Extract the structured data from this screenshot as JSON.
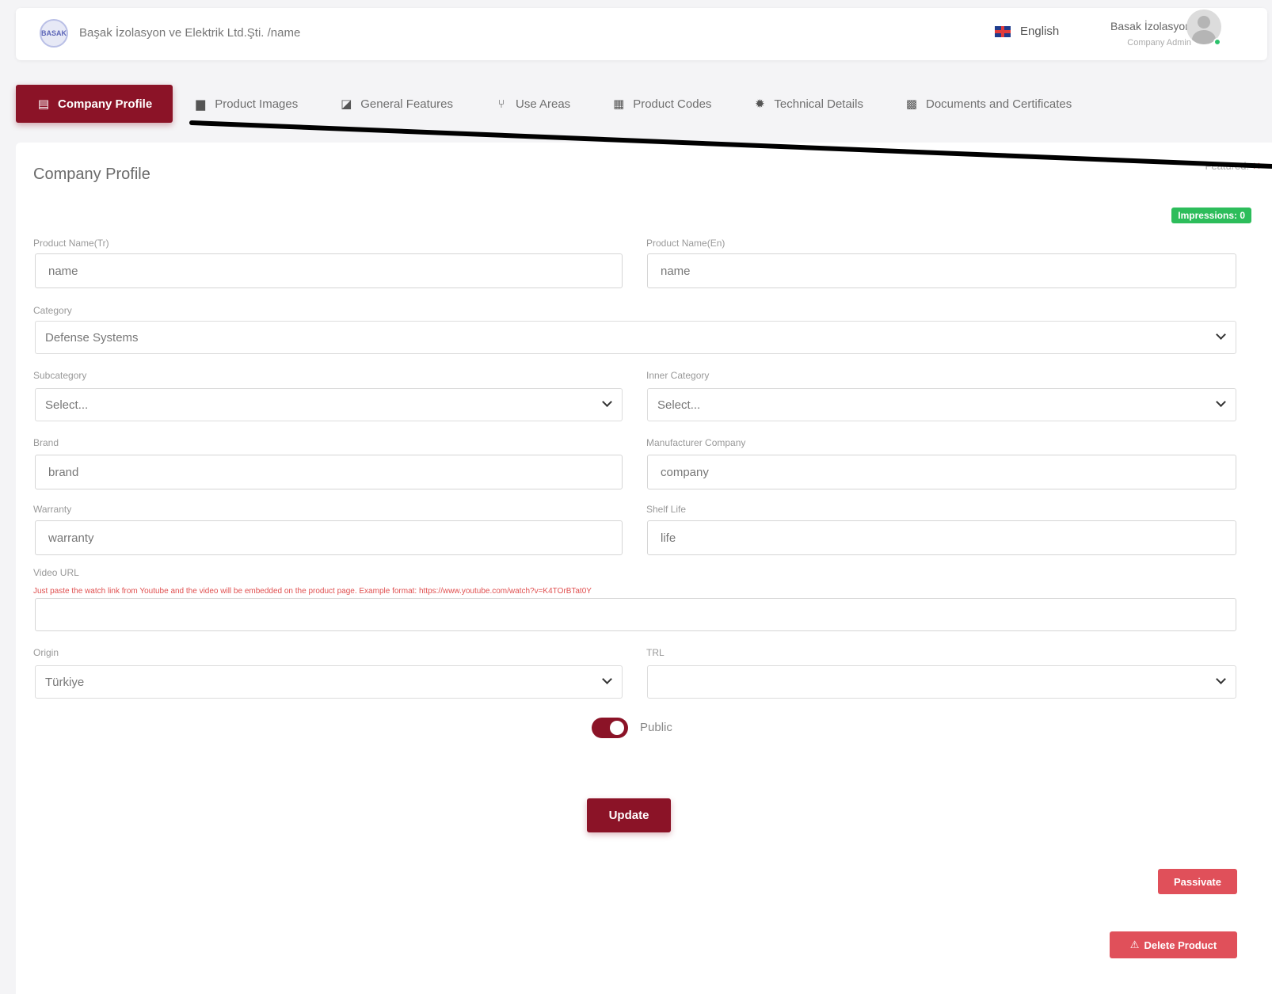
{
  "header": {
    "logo_text": "BASAK",
    "breadcrumb": "Başak İzolasyon ve Elektrik Ltd.Şti. /name",
    "language": "English",
    "user_name": "Basak İzolasyon",
    "user_role": "Company Admin"
  },
  "tabs": [
    {
      "label": "Company Profile",
      "icon": "id-card-icon",
      "glyph": "▤",
      "active": true
    },
    {
      "label": "Product Images",
      "icon": "image-icon",
      "glyph": "▆"
    },
    {
      "label": "General Features",
      "icon": "panel-icon",
      "glyph": "◪"
    },
    {
      "label": "Use Areas",
      "icon": "branch-icon",
      "glyph": "⑂"
    },
    {
      "label": "Product Codes",
      "icon": "qr-code-icon",
      "glyph": "▦"
    },
    {
      "label": "Technical Details",
      "icon": "gear-icon",
      "glyph": "✹"
    },
    {
      "label": "Documents and Certificates",
      "icon": "certificate-icon",
      "glyph": "▩"
    }
  ],
  "card": {
    "title": "Company Profile",
    "featured_label": "Featured:",
    "featured_value": "✕",
    "impressions": "Impressions: 0"
  },
  "form": {
    "product_name_tr": {
      "label": "Product Name(Tr)",
      "value": "name"
    },
    "product_name_en": {
      "label": "Product Name(En)",
      "value": "name"
    },
    "category": {
      "label": "Category",
      "value": "Defense Systems"
    },
    "subcategory": {
      "label": "Subcategory",
      "value": "Select..."
    },
    "inner_category": {
      "label": "Inner Category",
      "value": "Select..."
    },
    "brand": {
      "label": "Brand",
      "value": "brand"
    },
    "manufacturer": {
      "label": "Manufacturer Company",
      "value": "company"
    },
    "warranty": {
      "label": "Warranty",
      "value": "warranty"
    },
    "shelf_life": {
      "label": "Shelf Life",
      "value": "life"
    },
    "video_url": {
      "label": "Video URL",
      "hint": "Just paste the watch link from Youtube and the video will be embedded on the product page. Example format: https://www.youtube.com/watch?v=K4TOrBTat0Y",
      "value": ""
    },
    "origin": {
      "label": "Origin",
      "value": "Türkiye"
    },
    "trl": {
      "label": "TRL",
      "value": ""
    },
    "public_label": "Public",
    "public_on": true
  },
  "actions": {
    "update": "Update",
    "passivate": "Passivate",
    "delete": "Delete Product",
    "delete_icon": "⚠"
  },
  "colors": {
    "brand": "#8b1327",
    "danger": "#e0505a",
    "success": "#2dbd5b"
  }
}
